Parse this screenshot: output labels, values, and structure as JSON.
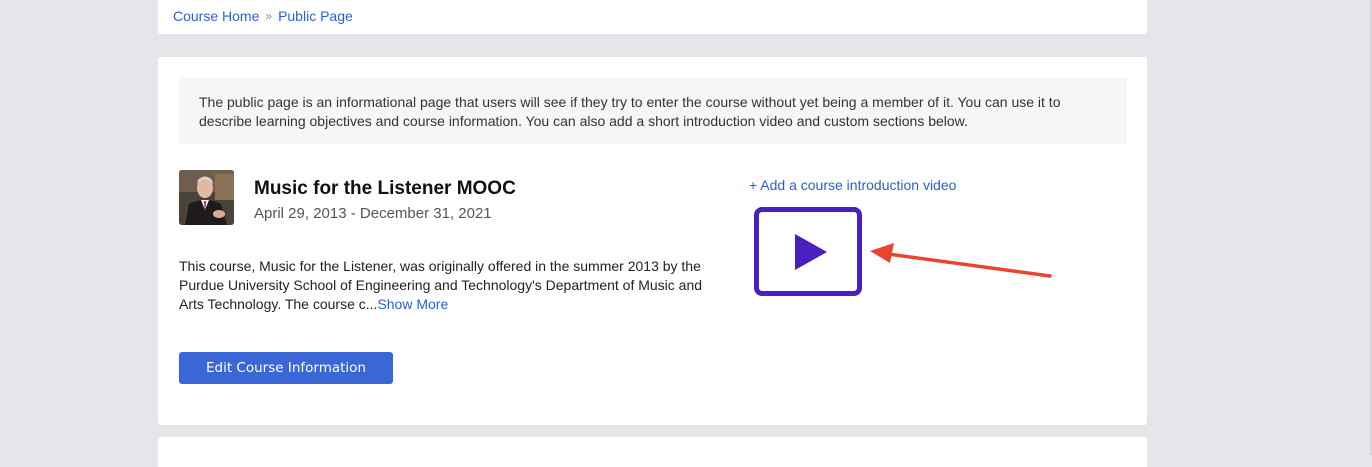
{
  "breadcrumb": {
    "home_label": "Course Home",
    "separator": "»",
    "current_label": "Public Page"
  },
  "info_box": {
    "text": "The public page is an informational page that users will see if they try to enter the course without yet being a member of it. You can use it to describe learning objectives and course information. You can also add a short introduction video and custom sections below."
  },
  "course": {
    "title": "Music for the Listener MOOC",
    "dates": "April 29, 2013 - December 31, 2021",
    "description": "This course, Music for the Listener, was originally offered in the summer 2013 by the Purdue University School of Engineering and Technology's Department of Music and Arts Technology. The course c...",
    "show_more_label": "Show More",
    "edit_button_label": "Edit Course Information"
  },
  "video": {
    "add_link_label": "+ Add a course introduction video",
    "icon": "play-icon"
  },
  "colors": {
    "link": "#2a5fd6",
    "button": "#3b67d6",
    "play_accent": "#4a1fbf",
    "annotation_arrow": "#e8452c",
    "page_background": "#e5e6ea"
  }
}
